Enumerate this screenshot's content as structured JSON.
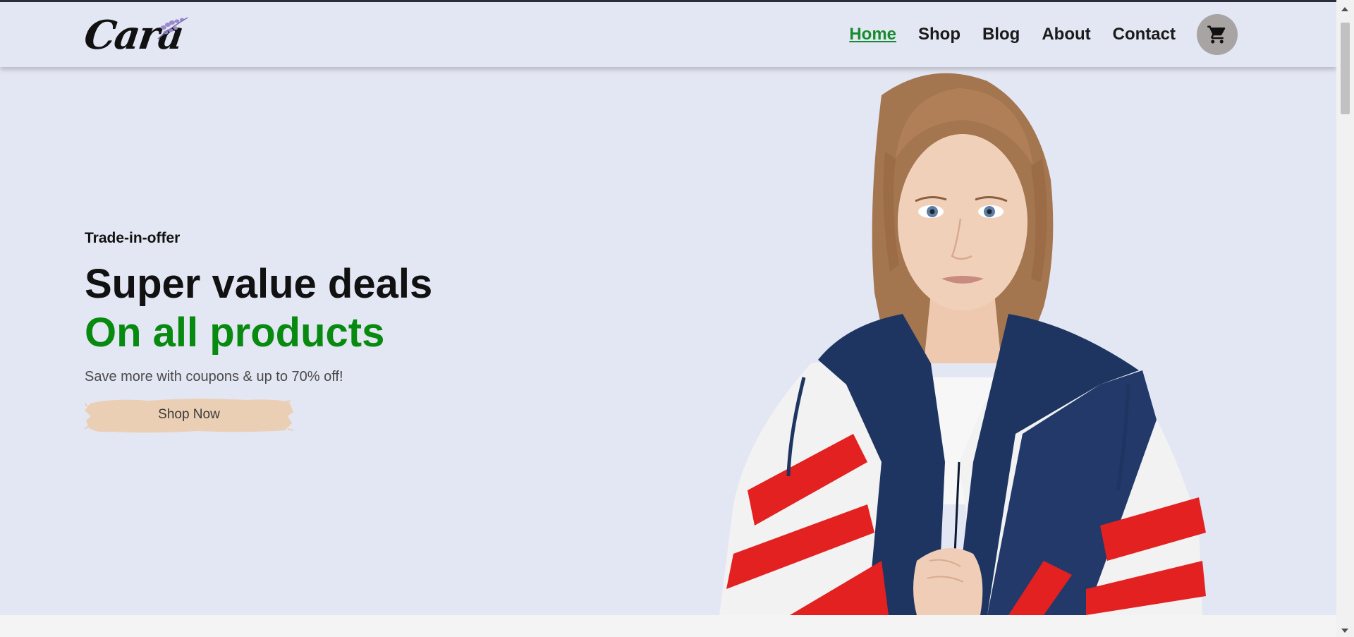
{
  "header": {
    "logo_text": "Cara",
    "nav": [
      {
        "label": "Home",
        "active": true
      },
      {
        "label": "Shop",
        "active": false
      },
      {
        "label": "Blog",
        "active": false
      },
      {
        "label": "About",
        "active": false
      },
      {
        "label": "Contact",
        "active": false
      }
    ],
    "cart_icon": "shopping-cart-icon"
  },
  "hero": {
    "eyebrow": "Trade-in-offer",
    "heading_line1": "Super value deals",
    "heading_line2": "On all products",
    "subtext": "Save more with coupons & up to 70% off!",
    "button_label": "Shop Now"
  },
  "colors": {
    "background": "#e3e6f3",
    "accent_green": "#088a10",
    "nav_active": "#178c2e",
    "button_brush": "#ebcfb4",
    "cart_circle": "#a8a4a4"
  }
}
